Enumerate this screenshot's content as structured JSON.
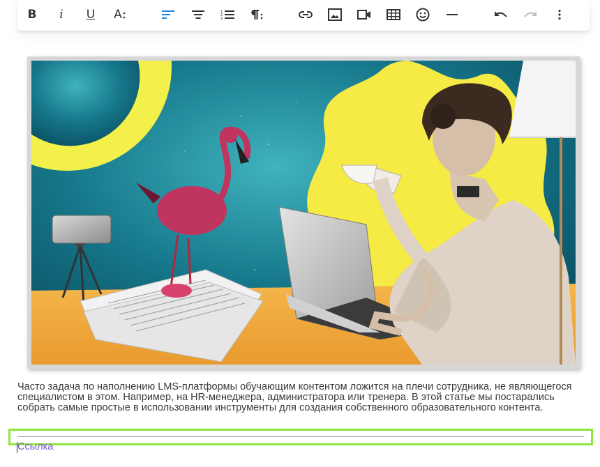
{
  "toolbar": {
    "bold_label": "B",
    "italic_label": "i",
    "underline_label": "U",
    "font_size_label": "A",
    "buttons": [
      "bold-button",
      "italic-button",
      "underline-button",
      "font-size-button",
      "align-left-button",
      "align-center-button",
      "numbered-list-button",
      "paragraph-format-button",
      "insert-link-button",
      "insert-image-button",
      "insert-video-button",
      "insert-table-button",
      "emoji-button",
      "horizontal-line-button",
      "undo-button",
      "redo-button",
      "more-options-button"
    ],
    "active_color": "#1e88e5",
    "disabled_color": "#bdbdbd"
  },
  "content": {
    "paragraph": "Часто задача по наполнению LMS-платформы обучающим контентом ложится на плечи сотрудника, не являющегося специалистом в этом. Например, на HR-менеджера, администратора или тренера. В этой статье мы постарались собрать самые простые в использовании инструменты для создания собственного образовательного контента.",
    "link_text": "Ссылка"
  },
  "colors": {
    "selection_outline": "#8ee63b",
    "link": "#7b58d6",
    "text": "#3a3a3a"
  }
}
